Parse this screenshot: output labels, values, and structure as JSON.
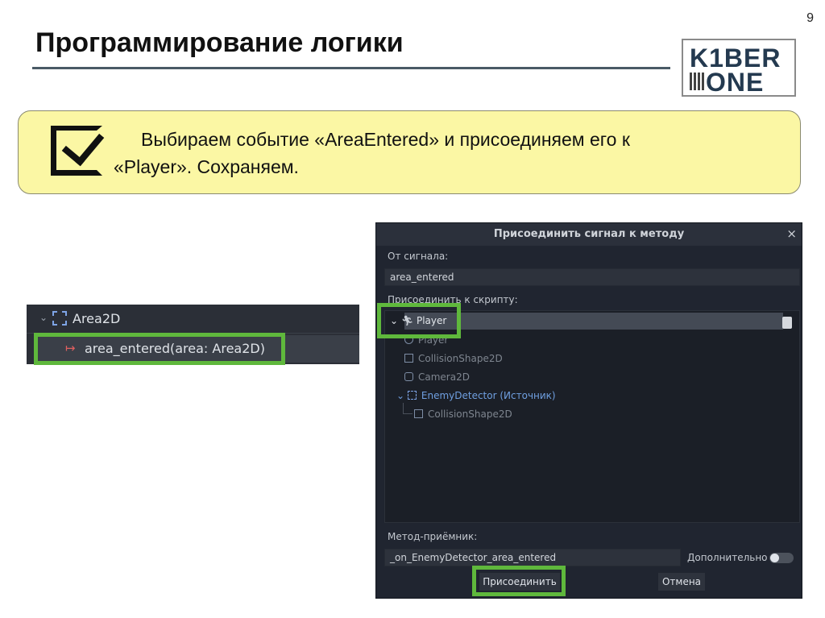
{
  "slide": {
    "page_number": "9",
    "title": "Программирование логики",
    "logo": {
      "row1": "K1BER",
      "row2": "ONE"
    },
    "note": {
      "line1": "Выбираем событие «AreaEntered» и присоединяем его к",
      "line2": "«Player». Сохраняем."
    }
  },
  "signal_panel": {
    "parent": "Area2D",
    "signal": "area_entered(area: Area2D)"
  },
  "dialog": {
    "title": "Присоединить сигнал к методу",
    "close": "×",
    "from_signal_label": "От сигнала:",
    "from_signal_value": "area_entered",
    "connect_to_script_label": "Присоединить к скрипту:",
    "tree": [
      {
        "label": "Player",
        "state": "selected"
      },
      {
        "label": "Player",
        "state": "dim"
      },
      {
        "label": "CollisionShape2D",
        "state": "dim"
      },
      {
        "label": "Camera2D",
        "state": "dim"
      },
      {
        "label": "EnemyDetector (Источник)",
        "state": "source"
      },
      {
        "label": "CollisionShape2D",
        "state": "dim"
      }
    ],
    "receiver_method_label": "Метод-приёмник:",
    "receiver_method_value": "_on_EnemyDetector_area_entered",
    "advanced_label": "Дополнительно",
    "connect_button": "Присоединить",
    "cancel_button": "Отмена"
  },
  "colors": {
    "highlight_green": "#5fb83c",
    "note_background": "#fbf7a4",
    "signal_icon": "#e06060",
    "source_node": "#6f9fe0"
  }
}
